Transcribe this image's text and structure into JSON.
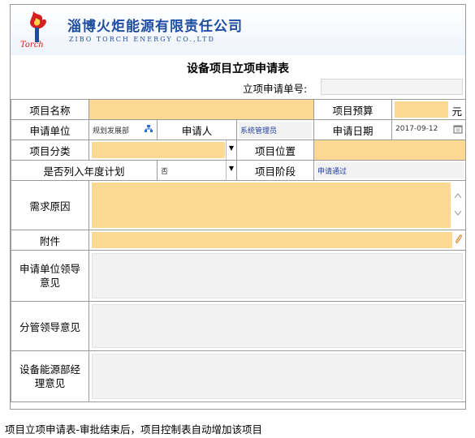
{
  "header": {
    "company_cn": "淄博火炬能源有限责任公司",
    "company_en": "ZIBO TORCH ENERGY CO.,LTD",
    "logo_text": "Torch"
  },
  "form": {
    "title": "设备项目立项申请表",
    "request_no_label": "立项申请单号:",
    "request_no_value": "",
    "rows": {
      "project_name_label": "项目名称",
      "budget_label": "项目预算",
      "budget_unit": "元",
      "apply_dept_label": "申请单位",
      "apply_dept_value": "规划发展部",
      "applicant_label": "申请人",
      "applicant_value": "系统管理员",
      "apply_date_label": "申请日期",
      "apply_date_value": "2017-09-12",
      "category_label": "项目分类",
      "location_label": "项目位置",
      "annual_plan_label": "是否列入年度计划",
      "annual_plan_value": "否",
      "stage_label": "项目阶段",
      "stage_value": "申请通过",
      "reason_label": "需求原因",
      "attachment_label": "附件",
      "dept_leader_label": "申请单位领导意见",
      "charge_leader_label": "分管领导意见",
      "energy_mgr_label": "设备能源部经理意见"
    }
  },
  "caption": "项目立项申请表-审批结束后，项目控制表自动增加该项目",
  "colors": {
    "field_yellow": "#fbd995",
    "field_gray": "#f2f2f2",
    "brand_blue": "#1f4ea1",
    "logo_red": "#d42020"
  }
}
